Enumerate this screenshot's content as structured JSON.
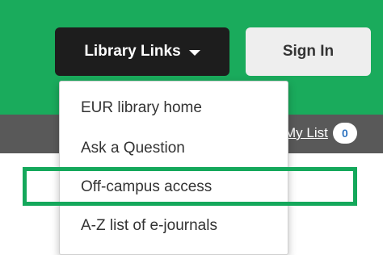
{
  "header": {
    "library_links_label": "Library Links",
    "sign_in_label": "Sign In",
    "accent_color": "#1aab5c"
  },
  "subbar": {
    "my_list_label": "My List",
    "my_list_count": "0"
  },
  "dropdown": {
    "items": [
      {
        "label": "EUR library home"
      },
      {
        "label": "Ask a Question"
      },
      {
        "label": "Off-campus access"
      },
      {
        "label": "A-Z list of e-journals"
      }
    ]
  },
  "highlight": {
    "target": "Off-campus access",
    "color": "#14a85b"
  }
}
